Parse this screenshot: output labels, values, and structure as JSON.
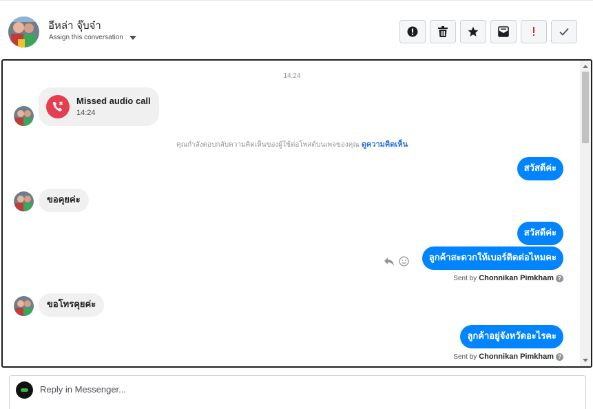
{
  "header": {
    "name": "อีหล่า จุ๊บจ๋า",
    "assign_label": "Assign this conversation",
    "actions": [
      {
        "name": "spam-button",
        "icon": "exclamation-circle-icon"
      },
      {
        "name": "delete-button",
        "icon": "trash-icon"
      },
      {
        "name": "star-button",
        "icon": "star-icon"
      },
      {
        "name": "mark-unread-button",
        "icon": "envelope-icon"
      },
      {
        "name": "follow-up-button",
        "icon": "exclamation-icon"
      },
      {
        "name": "mark-done-button",
        "icon": "check-icon"
      }
    ]
  },
  "chat": {
    "timestamp": "14:24",
    "missed_call": {
      "title": "Missed audio call",
      "time": "14:24"
    },
    "notice": {
      "text": "คุณกำลังตอบกลับความคิดเห็นของผู้ใช้ต่อโพสต์บนเพจของคุณ",
      "link": "ดูความคิดเห็น"
    },
    "messages": [
      {
        "side": "out",
        "text": "สวัสดีค่ะ"
      },
      {
        "side": "in",
        "text": "ขอคุยค่ะ"
      },
      {
        "side": "out",
        "text": "สวัสดีค่ะ"
      },
      {
        "side": "out",
        "text": "ลูกค้าสะดวกให้เบอร์ติดต่อไหมคะ"
      },
      {
        "side": "in",
        "text": "ขอโทรคุยค่ะ"
      },
      {
        "side": "out",
        "text": "ลูกค้าอยู่จังหวัดอะไรคะ"
      }
    ],
    "sent_by_label": "Sent by",
    "sent_by_name": "Chonnikan Pimkham"
  },
  "reply": {
    "placeholder": "Reply in Messenger..."
  },
  "colors": {
    "outgoing_bubble": "#0084ff",
    "incoming_bubble": "#f0f0f0",
    "missed_call_icon": "#e53e4f",
    "link": "#216fdb"
  }
}
